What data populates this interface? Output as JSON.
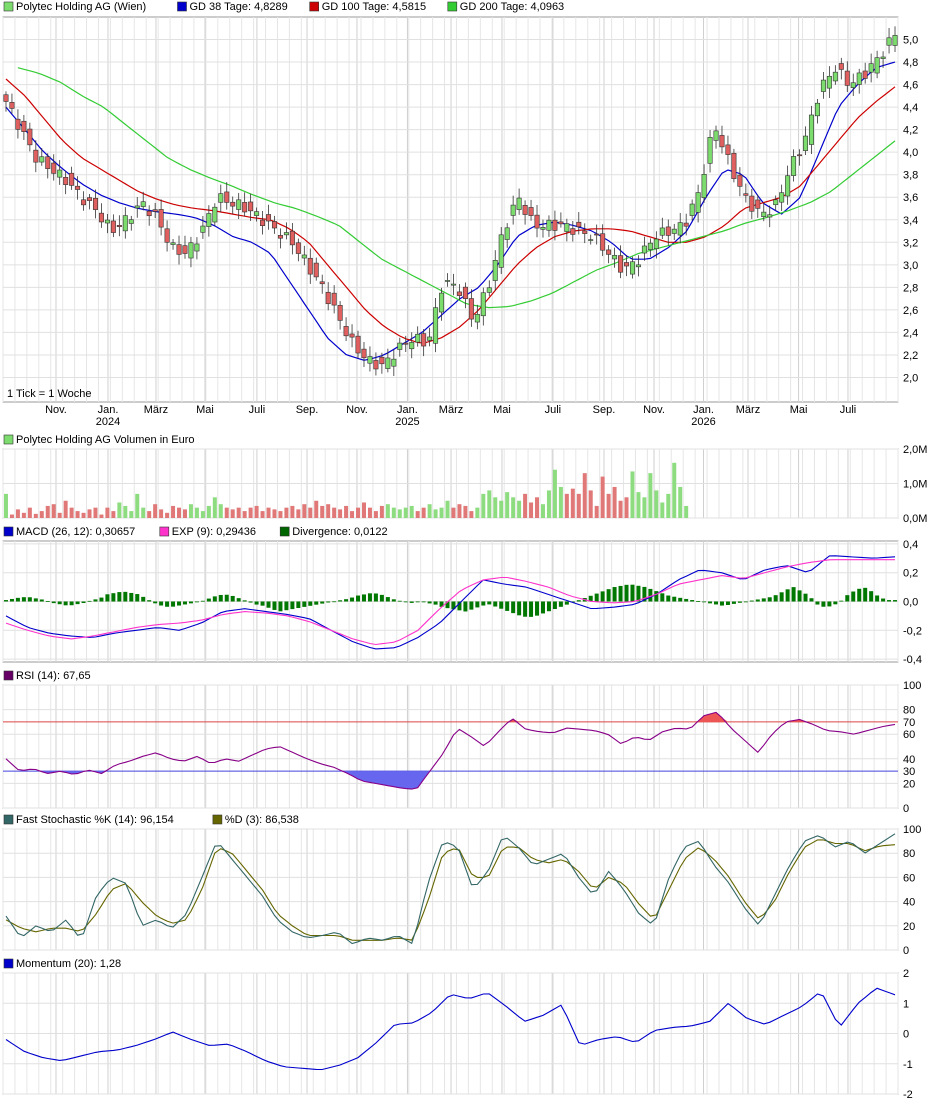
{
  "chart_data": {
    "type": "candlestick",
    "tick_note": "1 Tick = 1 Woche",
    "x_ticks": [
      {
        "label": "Nov.",
        "year": ""
      },
      {
        "label": "Jan.",
        "year": "2024"
      },
      {
        "label": "März",
        "year": ""
      },
      {
        "label": "Mai",
        "year": ""
      },
      {
        "label": "Juli",
        "year": ""
      },
      {
        "label": "Sep.",
        "year": ""
      },
      {
        "label": "Nov.",
        "year": ""
      },
      {
        "label": "Jan.",
        "year": "2025"
      },
      {
        "label": "März",
        "year": ""
      },
      {
        "label": "Mai",
        "year": ""
      },
      {
        "label": "Juli",
        "year": ""
      },
      {
        "label": "Sep.",
        "year": ""
      },
      {
        "label": "Nov.",
        "year": ""
      },
      {
        "label": "Jan.",
        "year": "2026"
      },
      {
        "label": "März",
        "year": ""
      },
      {
        "label": "Mai",
        "year": ""
      },
      {
        "label": "Juli",
        "year": ""
      }
    ],
    "panels": [
      {
        "id": "price",
        "legend": [
          {
            "text": "Polytec Holding AG (Wien)",
            "color": "#7ddc6e"
          },
          {
            "text": "GD 38 Tage: 4,8289",
            "color": "#0000cc"
          },
          {
            "text": "GD 100 Tage: 4,5815",
            "color": "#cc0000"
          },
          {
            "text": "GD 200 Tage: 4,0963",
            "color": "#33cc33"
          }
        ],
        "y_ticks": [
          "2,0",
          "2,2",
          "2,4",
          "2,6",
          "2,8",
          "3,0",
          "3,2",
          "3,4",
          "3,6",
          "3,8",
          "4,0",
          "4,2",
          "4,4",
          "4,6",
          "4,8",
          "5,0"
        ],
        "ylim": [
          1.8,
          5.2
        ],
        "close_anchors": [
          4.45,
          4.2,
          3.95,
          3.85,
          3.75,
          3.6,
          3.48,
          3.3,
          3.4,
          3.55,
          3.42,
          3.15,
          3.1,
          3.3,
          3.6,
          3.55,
          3.5,
          3.4,
          3.3,
          3.2,
          3.0,
          2.8,
          2.55,
          2.3,
          2.15,
          2.1,
          2.25,
          2.35,
          2.3,
          2.85,
          2.8,
          2.5,
          2.8,
          3.3,
          3.6,
          3.35,
          3.35,
          3.35,
          3.3,
          3.25,
          3.1,
          2.95,
          3.05,
          3.25,
          3.3,
          3.35,
          3.65,
          4.25,
          3.9,
          3.6,
          3.45,
          3.5,
          3.85,
          4.1,
          4.55,
          4.75,
          4.6,
          4.7,
          4.85,
          5.05
        ],
        "series": [
          {
            "name": "GD 38 Tage",
            "color": "#0000cc",
            "values": [
              4.4,
              4.2,
              4.0,
              3.85,
              3.72,
              3.62,
              3.55,
              3.5,
              3.47,
              3.45,
              3.42,
              3.35,
              3.25,
              3.2,
              3.1,
              2.85,
              2.6,
              2.35,
              2.2,
              2.15,
              2.2,
              2.3,
              2.4,
              2.55,
              2.7,
              2.8,
              3.0,
              3.25,
              3.35,
              3.38,
              3.35,
              3.3,
              3.2,
              3.05,
              3.05,
              3.15,
              3.3,
              3.6,
              3.85,
              3.8,
              3.55,
              3.45,
              3.6,
              4.0,
              4.4,
              4.6,
              4.75,
              4.8
            ]
          },
          {
            "name": "GD 100 Tage",
            "color": "#cc0000",
            "values": [
              4.65,
              4.5,
              4.3,
              4.1,
              3.95,
              3.85,
              3.75,
              3.65,
              3.58,
              3.53,
              3.5,
              3.48,
              3.45,
              3.42,
              3.4,
              3.32,
              3.2,
              3.0,
              2.8,
              2.6,
              2.45,
              2.35,
              2.3,
              2.35,
              2.45,
              2.6,
              2.8,
              3.0,
              3.15,
              3.25,
              3.3,
              3.32,
              3.32,
              3.3,
              3.25,
              3.2,
              3.2,
              3.25,
              3.35,
              3.5,
              3.55,
              3.6,
              3.7,
              3.9,
              4.1,
              4.3,
              4.45,
              4.58
            ]
          },
          {
            "name": "GD 200 Tage",
            "color": "#33cc33",
            "values": [
              4.75,
              4.7,
              4.62,
              4.5,
              4.4,
              4.25,
              4.1,
              3.95,
              3.85,
              3.77,
              3.7,
              3.62,
              3.55,
              3.5,
              3.43,
              3.35,
              3.2,
              3.05,
              2.95,
              2.85,
              2.75,
              2.65,
              2.62,
              2.63,
              2.68,
              2.75,
              2.85,
              2.95,
              3.02,
              3.1,
              3.15,
              3.2,
              3.25,
              3.3,
              3.37,
              3.42,
              3.48,
              3.55,
              3.65,
              3.8,
              3.95,
              4.1
            ]
          }
        ]
      },
      {
        "id": "volume",
        "legend": [
          {
            "text": "Polytec Holding AG Volumen in Euro",
            "color": "#7ddc6e"
          }
        ],
        "y_ticks": [
          "0,0M",
          "1,0M",
          "2,0M"
        ],
        "ylim": [
          0,
          2.0
        ],
        "values": [
          0.7,
          0.1,
          0.25,
          0.15,
          0.3,
          0.12,
          0.2,
          0.35,
          0.4,
          0.15,
          0.5,
          0.3,
          0.2,
          0.15,
          0.25,
          0.3,
          0.1,
          0.3,
          0.2,
          0.45,
          0.35,
          0.2,
          0.7,
          0.3,
          0.2,
          0.4,
          0.25,
          0.15,
          0.35,
          0.3,
          0.25,
          0.4,
          0.3,
          0.2,
          0.35,
          0.6,
          0.4,
          0.3,
          0.25,
          0.3,
          0.2,
          0.3,
          0.35,
          0.2,
          0.3,
          0.25,
          0.2,
          0.3,
          0.35,
          0.25,
          0.4,
          0.3,
          0.5,
          0.35,
          0.4,
          0.3,
          0.25,
          0.35,
          0.2,
          0.3,
          0.45,
          0.3,
          0.2,
          0.35,
          0.4,
          0.3,
          0.25,
          0.3,
          0.35,
          0.2,
          0.3,
          0.4,
          0.25,
          0.3,
          0.5,
          0.3,
          0.4,
          0.35,
          0.2,
          0.3,
          0.7,
          0.8,
          0.6,
          0.5,
          0.75,
          0.6,
          0.5,
          0.7,
          0.45,
          0.6,
          0.4,
          0.8,
          1.4,
          0.9,
          0.7,
          0.85,
          0.7,
          1.3,
          0.8,
          0.35,
          1.2,
          0.7,
          0.9,
          0.5,
          0.6,
          1.35,
          0.75,
          0.6,
          1.3,
          0.8,
          0.45,
          0.7,
          1.6,
          0.9,
          0.35
        ]
      },
      {
        "id": "macd",
        "legend": [
          {
            "text": "MACD (26, 12): 0,30657",
            "color": "#0000cc"
          },
          {
            "text": "EXP (9): 0,29436",
            "color": "#ff33cc"
          },
          {
            "text": "Divergence: 0,0122",
            "color": "#006600"
          }
        ],
        "y_ticks": [
          "-0,4",
          "-0,2",
          "0,0",
          "0,2",
          "0,4"
        ],
        "ylim": [
          -0.42,
          0.42
        ],
        "series": [
          {
            "name": "MACD",
            "color": "#0000cc",
            "values": [
              -0.1,
              -0.18,
              -0.22,
              -0.24,
              -0.25,
              -0.22,
              -0.2,
              -0.18,
              -0.2,
              -0.15,
              -0.07,
              -0.05,
              -0.07,
              -0.09,
              -0.12,
              -0.2,
              -0.28,
              -0.33,
              -0.32,
              -0.25,
              -0.15,
              0.0,
              0.15,
              0.12,
              0.1,
              0.05,
              0.0,
              -0.05,
              -0.04,
              -0.02,
              0.05,
              0.15,
              0.22,
              0.2,
              0.15,
              0.22,
              0.25,
              0.2,
              0.32,
              0.31,
              0.3,
              0.31
            ]
          },
          {
            "name": "EXP",
            "color": "#ff33cc",
            "values": [
              -0.15,
              -0.2,
              -0.24,
              -0.26,
              -0.24,
              -0.21,
              -0.18,
              -0.16,
              -0.15,
              -0.13,
              -0.09,
              -0.07,
              -0.08,
              -0.1,
              -0.14,
              -0.2,
              -0.26,
              -0.3,
              -0.28,
              -0.2,
              -0.05,
              0.08,
              0.15,
              0.17,
              0.14,
              0.1,
              0.04,
              0.0,
              -0.01,
              0.0,
              0.05,
              0.12,
              0.15,
              0.18,
              0.16,
              0.2,
              0.24,
              0.27,
              0.29,
              0.29,
              0.29,
              0.29
            ]
          },
          {
            "name": "Divergence",
            "color": "#006600",
            "values": [
              0.01,
              0.02,
              0.03,
              0.03,
              0.02,
              0.01,
              -0.01,
              -0.02,
              -0.03,
              -0.02,
              -0.01,
              0.01,
              0.02,
              0.05,
              0.06,
              0.07,
              0.06,
              0.05,
              0.02,
              -0.01,
              -0.03,
              -0.04,
              -0.03,
              -0.02,
              -0.01,
              0.0,
              0.02,
              0.04,
              0.05,
              0.04,
              0.02,
              0.0,
              -0.02,
              -0.03,
              -0.05,
              -0.07,
              -0.06,
              -0.05,
              -0.04,
              -0.03,
              -0.02,
              -0.01,
              0.0,
              0.01,
              0.02,
              0.04,
              0.05,
              0.06,
              0.05,
              0.03,
              0.01,
              0.0,
              -0.01,
              0.0,
              -0.01,
              -0.02,
              -0.04,
              -0.05,
              -0.06,
              -0.07,
              -0.05,
              -0.03,
              -0.02,
              -0.04,
              -0.06,
              -0.08,
              -0.1,
              -0.11,
              -0.1,
              -0.08,
              -0.06,
              -0.04,
              -0.02,
              0.0,
              0.02,
              0.04,
              0.06,
              0.08,
              0.1,
              0.11,
              0.12,
              0.11,
              0.1,
              0.08,
              0.06,
              0.04,
              0.03,
              0.02,
              0.01,
              0.0,
              -0.01,
              -0.02,
              -0.03,
              -0.02,
              -0.01,
              0.0,
              0.01,
              0.02,
              0.03,
              0.05,
              0.08,
              0.1,
              0.07,
              0.04,
              -0.02,
              -0.04,
              -0.03,
              0.0,
              0.05,
              0.08,
              0.1,
              0.07,
              0.03,
              0.01,
              0.01
            ]
          }
        ]
      },
      {
        "id": "rsi",
        "legend": [
          {
            "text": "RSI (14): 67,65",
            "color": "#660066"
          }
        ],
        "y_ticks": [
          "0",
          "20",
          "40",
          "60",
          "80",
          "100"
        ],
        "reference_labels": [
          "30",
          "70"
        ],
        "ylim": [
          0,
          100
        ],
        "values": [
          40,
          30,
          32,
          28,
          30,
          27,
          31,
          28,
          35,
          38,
          42,
          45,
          40,
          38,
          42,
          36,
          40,
          38,
          43,
          48,
          50,
          45,
          40,
          36,
          33,
          28,
          22,
          20,
          18,
          16,
          15,
          30,
          45,
          65,
          58,
          50,
          62,
          73,
          64,
          62,
          61,
          65,
          64,
          63,
          60,
          52,
          58,
          55,
          62,
          65,
          64,
          75,
          78,
          65,
          55,
          45,
          60,
          70,
          72,
          68,
          63,
          62,
          60,
          63,
          66,
          68
        ]
      },
      {
        "id": "stoch",
        "legend": [
          {
            "text": "Fast Stochastic %K (14): 96,154",
            "color": "#336666"
          },
          {
            "text": "%D (3): 86,538",
            "color": "#666600"
          }
        ],
        "y_ticks": [
          "0",
          "20",
          "40",
          "60",
          "80",
          "100"
        ],
        "ylim": [
          0,
          100
        ],
        "series": [
          {
            "name": "%K",
            "color": "#336666",
            "values": [
              28,
              10,
              20,
              15,
              25,
              8,
              45,
              60,
              55,
              20,
              25,
              18,
              30,
              60,
              90,
              75,
              60,
              45,
              25,
              15,
              10,
              12,
              15,
              5,
              10,
              8,
              12,
              5,
              55,
              90,
              85,
              50,
              65,
              95,
              85,
              70,
              75,
              80,
              60,
              45,
              65,
              50,
              30,
              20,
              60,
              85,
              90,
              70,
              55,
              35,
              20,
              45,
              70,
              90,
              95,
              85,
              90,
              80,
              88,
              96
            ]
          },
          {
            "name": "%D",
            "color": "#666600",
            "values": [
              25,
              18,
              15,
              18,
              18,
              15,
              30,
              50,
              55,
              40,
              28,
              22,
              25,
              50,
              85,
              80,
              65,
              50,
              30,
              20,
              12,
              12,
              12,
              8,
              8,
              8,
              10,
              8,
              40,
              80,
              85,
              60,
              60,
              85,
              85,
              75,
              72,
              75,
              65,
              50,
              60,
              55,
              38,
              25,
              50,
              75,
              85,
              75,
              60,
              40,
              25,
              40,
              65,
              85,
              92,
              88,
              88,
              82,
              86,
              87
            ]
          }
        ]
      },
      {
        "id": "momentum",
        "legend": [
          {
            "text": "Momentum (20): 1,28",
            "color": "#0000cc"
          }
        ],
        "y_ticks": [
          "-2",
          "-1",
          "0",
          "1",
          "2"
        ],
        "ylim": [
          -2,
          2
        ],
        "values": [
          -0.2,
          -0.6,
          -0.8,
          -0.9,
          -0.75,
          -0.6,
          -0.55,
          -0.4,
          -0.2,
          0.05,
          -0.2,
          -0.4,
          -0.35,
          -0.6,
          -0.9,
          -1.1,
          -1.15,
          -1.2,
          -1.05,
          -0.8,
          -0.3,
          0.3,
          0.35,
          0.7,
          1.3,
          1.15,
          1.35,
          0.9,
          0.4,
          0.6,
          0.95,
          -0.4,
          -0.2,
          -0.1,
          -0.3,
          0.1,
          0.2,
          0.25,
          0.4,
          1.0,
          0.5,
          0.3,
          0.6,
          0.9,
          1.4,
          0.2,
          1.0,
          1.5,
          1.28
        ]
      }
    ]
  }
}
